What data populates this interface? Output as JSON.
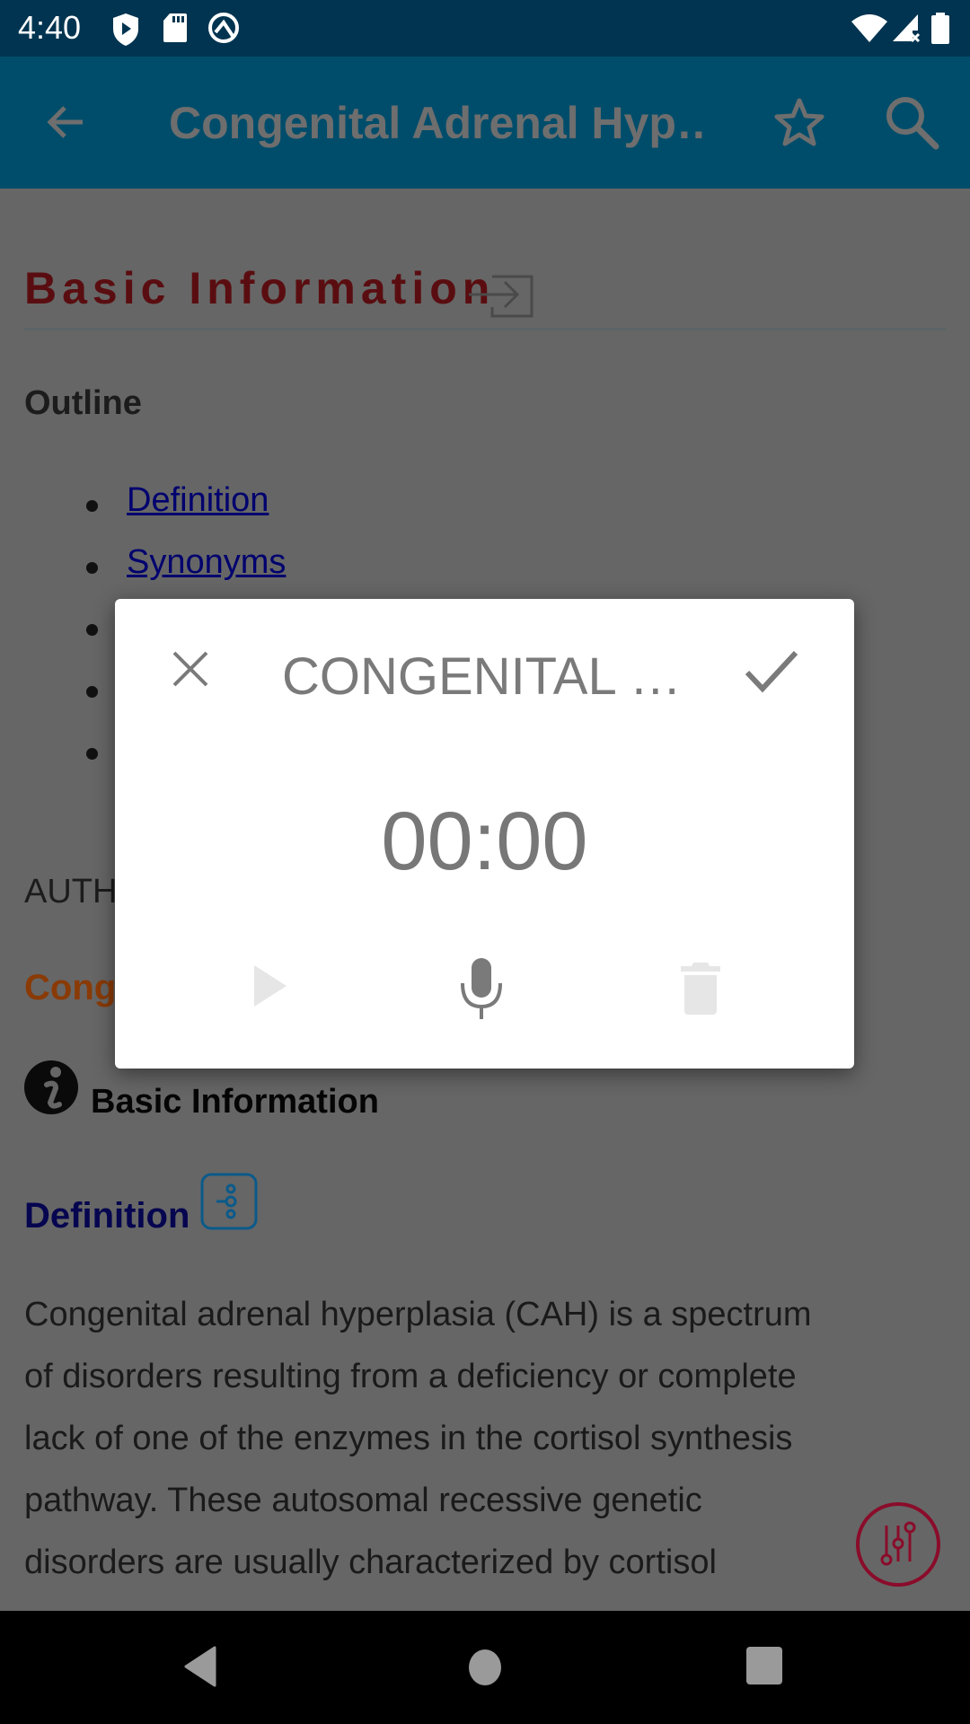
{
  "status_bar": {
    "time": "4:40",
    "left_icons": [
      "play-protect-icon",
      "sd-card-icon",
      "data-saver-icon"
    ],
    "right_icons": [
      "wifi-icon",
      "cell-signal-no-data-icon",
      "battery-icon"
    ]
  },
  "app_bar": {
    "back_icon": "arrow-back-icon",
    "title": "Congenital Adrenal Hyp…",
    "actions": [
      "star-icon",
      "search-icon"
    ]
  },
  "content": {
    "section_heading": "Basic Information",
    "section_heading_icon": "enter-arrow-icon",
    "outline_label": "Outline",
    "outline_items": [
      "Definition",
      "Synonyms"
    ],
    "authors_prefix": "AUTH",
    "topic_prefix": "Cong",
    "basic_info_label": "Basic Information",
    "basic_info_icon": "info-icon",
    "definition_label": "Definition",
    "definition_icon": "mind-map-icon",
    "definition_paragraph": [
      "Congenital adrenal hyperplasia (CAH) is a spectrum",
      "of disorders resulting from a deficiency or complete",
      "lack of one of the enzymes in the cortisol synthesis",
      "pathway. These autosomal recessive genetic",
      "disorders are usually characterized by cortisol"
    ],
    "fab_icon": "tune-sliders-icon"
  },
  "dialog": {
    "close_icon": "close-icon",
    "title": "CONGENITAL …",
    "confirm_icon": "check-icon",
    "timer": "00:00",
    "controls": [
      "play-icon",
      "microphone-icon",
      "delete-icon"
    ]
  },
  "nav_bar": {
    "buttons": [
      "back-triangle-icon",
      "home-circle-icon",
      "recents-square-icon"
    ]
  },
  "colors": {
    "status_bar": "#003450",
    "app_bar": "#004d6b",
    "heading": "#5a0d10",
    "link": "#00006e",
    "topic": "#8a3a05",
    "fab_accent": "#8a0c2a",
    "dialog_text": "#7a7a7a"
  }
}
